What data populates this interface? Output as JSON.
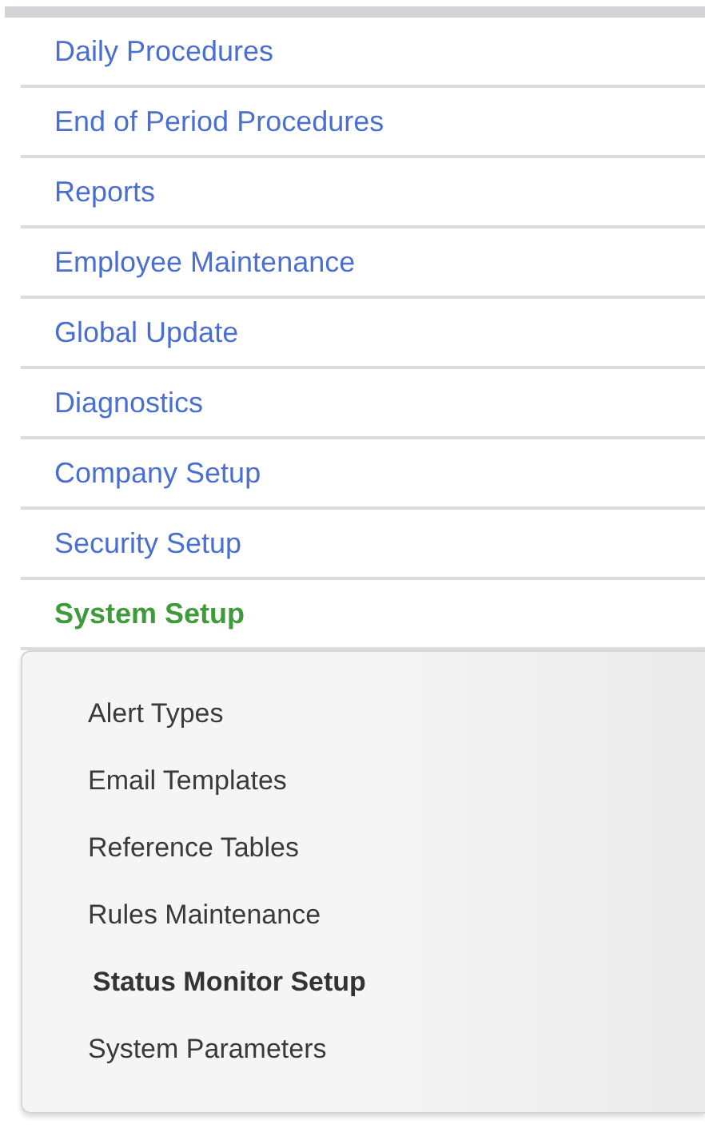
{
  "menu": {
    "items": [
      {
        "label": "Daily Procedures",
        "selected": false
      },
      {
        "label": "End of Period Procedures",
        "selected": false
      },
      {
        "label": "Reports",
        "selected": false
      },
      {
        "label": "Employee Maintenance",
        "selected": false
      },
      {
        "label": "Global Update",
        "selected": false
      },
      {
        "label": "Diagnostics",
        "selected": false
      },
      {
        "label": "Company Setup",
        "selected": false
      },
      {
        "label": "Security Setup",
        "selected": false
      },
      {
        "label": "System Setup",
        "selected": true,
        "expanded": true,
        "children": [
          {
            "label": "Alert Types",
            "selected": false
          },
          {
            "label": "Email Templates",
            "selected": false
          },
          {
            "label": "Reference Tables",
            "selected": false
          },
          {
            "label": "Rules Maintenance",
            "selected": false
          },
          {
            "label": "Status Monitor Setup",
            "selected": true
          },
          {
            "label": "System Parameters",
            "selected": false
          }
        ]
      }
    ]
  }
}
